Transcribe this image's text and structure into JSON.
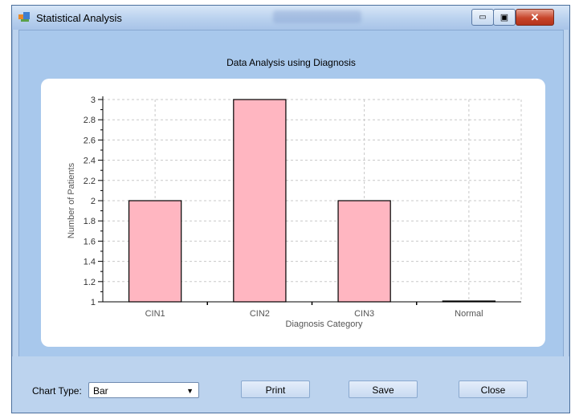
{
  "window": {
    "title": "Statistical Analysis",
    "minimize_symbol": "▭",
    "maximize_symbol": "▣",
    "close_symbol": "✕"
  },
  "chart_title": "Data Analysis using Diagnosis",
  "chart_data": {
    "type": "bar",
    "categories": [
      "CIN1",
      "CIN2",
      "CIN3",
      "Normal"
    ],
    "values": [
      2,
      3,
      2,
      1
    ],
    "xlabel": "Diagnosis Category",
    "ylabel": "Number of Patients",
    "ylim": [
      1,
      3
    ],
    "yticks": [
      "1",
      "1.2",
      "1.4",
      "1.6",
      "1.8",
      "2",
      "2.2",
      "2.4",
      "2.6",
      "2.8",
      "3"
    ],
    "grid": true,
    "bar_color": "#ffb6c1",
    "bar_edge_color": "#000000"
  },
  "controls": {
    "chart_type_label": "Chart Type:",
    "chart_type_value": "Bar",
    "print_label": "Print",
    "save_label": "Save",
    "close_label": "Close"
  },
  "colors": {
    "window_bg": "#bcd3ee",
    "client_bg": "#a8c8ec"
  }
}
